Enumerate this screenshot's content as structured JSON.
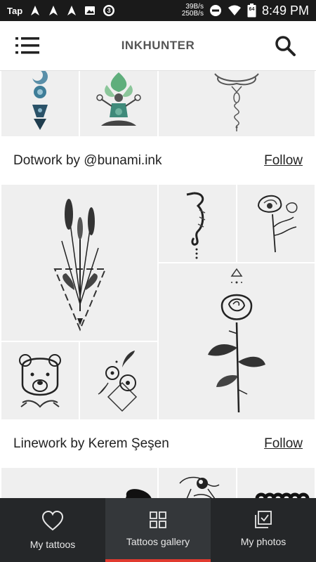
{
  "status_bar": {
    "carrier": "Tap",
    "notification_count": "3",
    "speed_up": "39B/s",
    "speed_down": "250B/s",
    "battery": "64",
    "time": "8:49 PM",
    "icons": [
      "navigation-icon",
      "navigation-icon",
      "navigation-icon",
      "image-icon",
      "settings-icon",
      "dnd-icon",
      "wifi-icon",
      "battery-icon"
    ]
  },
  "app_bar": {
    "title": "INKHUNTER",
    "left_icon": "menu-icon",
    "right_icon": "search-icon"
  },
  "galleries": [
    {
      "title": "Dotwork by @bunami.ink",
      "follow_label": "Follow"
    },
    {
      "title": "Linework by Kerem Şeşen",
      "follow_label": "Follow"
    }
  ],
  "bottom_nav": {
    "items": [
      {
        "label": "My tattoos",
        "icon": "heart-icon",
        "active": false
      },
      {
        "label": "Tattoos gallery",
        "icon": "grid-icon",
        "active": true
      },
      {
        "label": "My photos",
        "icon": "photos-icon",
        "active": false
      }
    ]
  },
  "colors": {
    "accent": "#e03a2f",
    "nav_background": "#252729",
    "nav_active_background": "#34373a",
    "tile_background": "#efefef"
  }
}
